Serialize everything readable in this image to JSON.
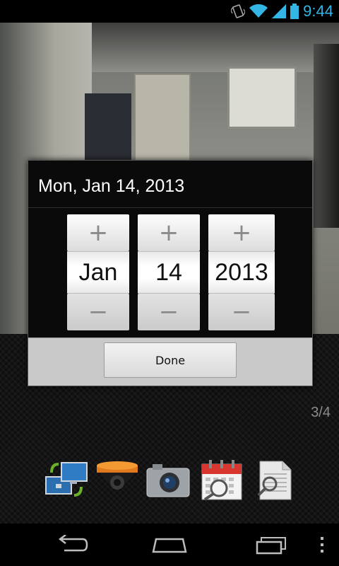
{
  "status_bar": {
    "time": "9:44",
    "icons": [
      "phone-vibrate-icon",
      "wifi-icon",
      "signal-icon",
      "battery-icon"
    ]
  },
  "date_dialog": {
    "title": "Mon, Jan 14, 2013",
    "pickers": [
      {
        "name": "month",
        "value": "Jan",
        "increment": "+",
        "decrement": "−"
      },
      {
        "name": "day",
        "value": "14",
        "increment": "+",
        "decrement": "−"
      },
      {
        "name": "year",
        "value": "2013",
        "increment": "+",
        "decrement": "−"
      }
    ],
    "done_label": "Done"
  },
  "page_indicator": "3/4",
  "toolbar": {
    "items": [
      "switch-view-icon",
      "dome-camera-icon",
      "snapshot-camera-icon",
      "calendar-search-icon",
      "document-search-icon"
    ]
  },
  "nav_bar": {
    "items": [
      "back-icon",
      "home-icon",
      "recent-apps-icon",
      "menu-icon"
    ]
  },
  "colors": {
    "accent": "#33b5e5",
    "dialog_bg": "#0a0a0a",
    "footer_bg": "#c9c9c9"
  }
}
